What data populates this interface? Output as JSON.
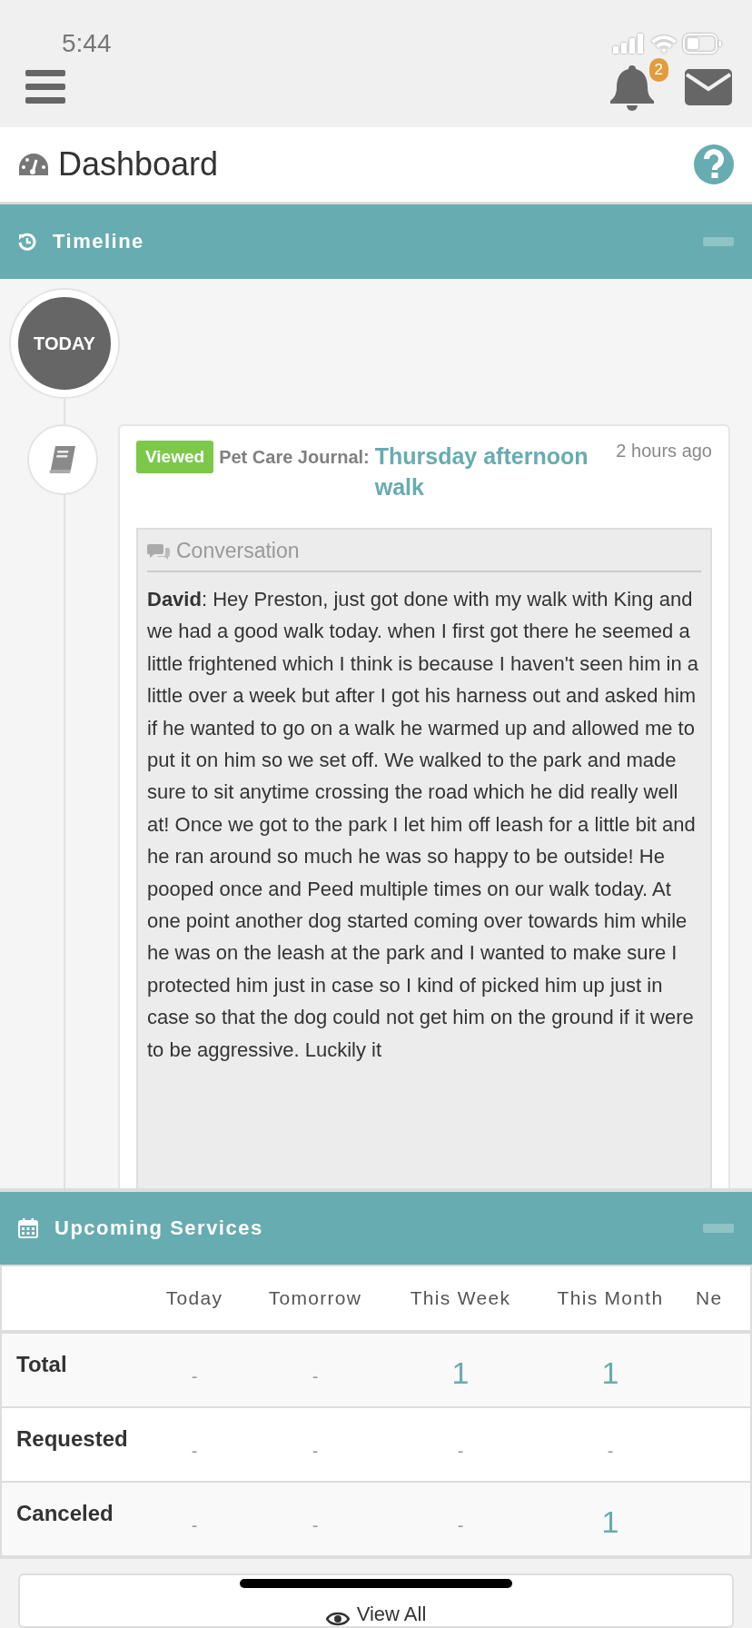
{
  "status_bar": {
    "time": "5:44"
  },
  "header": {
    "notification_count": "2"
  },
  "page": {
    "title": "Dashboard"
  },
  "timeline": {
    "title": "Timeline",
    "day_label": "TODAY",
    "entries": [
      {
        "badge": "Viewed",
        "type_label": "Pet Care Journal:",
        "title": "Thursday afternoon walk",
        "time": "2 hours ago",
        "section_title": "Conversation",
        "message": "**David**: Hey Preston, just got done with my walk with King and we had a good walk today. when I first got there he seemed a little frightened which I think is because I haven't seen him in a little over a week but after I got his harness out and asked him if he wanted to go on a walk he warmed up and allowed me to put it on him so we set off. We walked to the park and made sure to sit anytime crossing the road which he did really well at! Once we got to the park I let him off leash for a little bit and he ran around so much he was so happy to be outside! He pooped once and Peed multiple times on our walk today. At one point another dog started coming over towards him while he was on the leash at the park and I wanted to make sure I protected him just in case so I kind of picked him up just in case so that the dog could not get him on the ground if it were to be aggressive. Luckily it"
      }
    ]
  },
  "upcoming_services": {
    "title": "Upcoming Services",
    "columns": [
      "Today",
      "Tomorrow",
      "This Week",
      "This Month",
      "Ne"
    ],
    "rows": [
      {
        "label": "Total",
        "cells": [
          {
            "value": "-",
            "kind": "none"
          },
          {
            "value": "-",
            "kind": "none"
          },
          {
            "value": "1",
            "kind": "count"
          },
          {
            "value": "1",
            "kind": "count"
          }
        ]
      },
      {
        "label": "Requested",
        "cells": [
          {
            "value": "-",
            "kind": "none"
          },
          {
            "value": "-",
            "kind": "none"
          },
          {
            "value": "-",
            "kind": "none"
          },
          {
            "value": "-",
            "kind": "none"
          }
        ]
      },
      {
        "label": "Canceled",
        "cells": [
          {
            "value": "-",
            "kind": "none"
          },
          {
            "value": "-",
            "kind": "none"
          },
          {
            "value": "-",
            "kind": "none"
          },
          {
            "value": "1",
            "kind": "count"
          }
        ]
      }
    ]
  },
  "view_all": {
    "label": "View All"
  }
}
